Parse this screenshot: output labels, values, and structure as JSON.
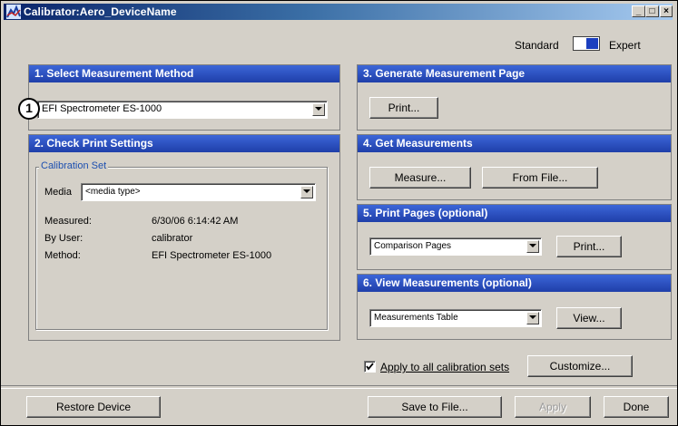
{
  "window": {
    "title": "Calibrator:Aero_DeviceName",
    "controls": {
      "minimize": "_",
      "maximize": "□",
      "close": "×"
    }
  },
  "mode": {
    "standard_label": "Standard",
    "expert_label": "Expert",
    "selected": "Expert"
  },
  "step1": {
    "header": "1. Select Measurement Method",
    "callout": "1",
    "instrument": "EFI Spectrometer ES-1000"
  },
  "step2": {
    "header": "2. Check Print Settings",
    "group_title": "Calibration Set",
    "media_label": "Media",
    "media_value": "<media type>",
    "measured_label": "Measured:",
    "measured_value": "6/30/06 6:14:42 AM",
    "user_label": "By User:",
    "user_value": "calibrator",
    "method_label": "Method:",
    "method_value": "EFI Spectrometer ES-1000"
  },
  "step3": {
    "header": "3. Generate Measurement Page",
    "print_button": "Print..."
  },
  "step4": {
    "header": "4. Get Measurements",
    "measure_button": "Measure...",
    "from_file_button": "From File..."
  },
  "step5": {
    "header": "5. Print Pages (optional)",
    "pages_value": "Comparison Pages",
    "print_button": "Print..."
  },
  "step6": {
    "header": "6. View Measurements (optional)",
    "view_value": "Measurements Table",
    "view_button": "View..."
  },
  "apply_all": {
    "label": "Apply to all calibration sets",
    "checked": true
  },
  "customize_button": "Customize...",
  "footer": {
    "restore_button": "Restore Device",
    "save_button": "Save to File...",
    "apply_button": "Apply",
    "done_button": "Done"
  },
  "colors": {
    "header_blue": "#2a4fc0",
    "title_bar": "#0a246a",
    "dialog_bg": "#d4d0c8"
  }
}
